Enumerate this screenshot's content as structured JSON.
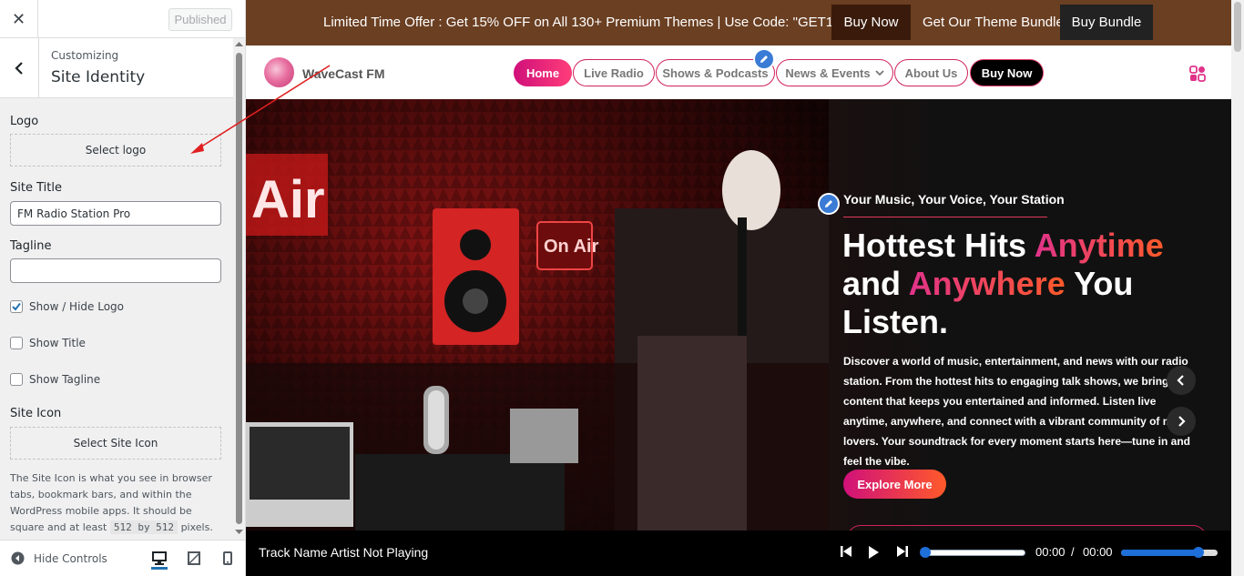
{
  "customizer": {
    "close_icon": "close-icon",
    "published_label": "Published",
    "customizing_label": "Customizing",
    "section_title": "Site Identity",
    "logo_label": "Logo",
    "select_logo_label": "Select logo",
    "site_title_label": "Site Title",
    "site_title_value": "FM Radio Station Pro",
    "tagline_label": "Tagline",
    "tagline_value": "",
    "checkboxes": [
      {
        "label": "Show / Hide Logo",
        "checked": true
      },
      {
        "label": "Show Title",
        "checked": false
      },
      {
        "label": "Show Tagline",
        "checked": false
      }
    ],
    "site_icon_label": "Site Icon",
    "select_site_icon_label": "Select Site Icon",
    "site_icon_desc_1": "The Site Icon is what you see in browser tabs, bookmark bars, and within the WordPress mobile apps. It should be square and at least",
    "site_icon_desc_code": "512 by 512",
    "site_icon_desc_2": "pixels.",
    "hide_controls_label": "Hide Controls",
    "device_icons": [
      "desktop-icon",
      "tablet-icon",
      "mobile-icon"
    ]
  },
  "preview": {
    "promo_text": "Limited Time Offer : Get 15% OFF on All 130+ Premium Themes | Use Code: \"GET15PRO\"",
    "promo_buy_now": "Buy Now",
    "theme_bundle_text": "Get Our Theme Bundle",
    "buy_bundle": "Buy Bundle",
    "brand": "WaveCast FM",
    "nav": [
      "Home",
      "Live Radio",
      "Shows & Podcasts",
      "News & Events",
      "About Us",
      "Buy Now"
    ],
    "hero_kicker": "Your Music, Your Voice, Your Station",
    "hero_title_1": "Hottest Hits ",
    "hero_title_2": "Anytime",
    "hero_title_3": "and ",
    "hero_title_4": "Anywhere",
    "hero_title_5": " You Listen.",
    "hero_desc": "Discover a world of music, entertainment, and news with our radio station. From the hottest hits to engaging talk shows, we bring you content that keeps you entertained and informed. Listen live anytime, anywhere, and connect with a vibrant community of music lovers. Your soundtrack for every moment starts here—tune in and feel the vibe.",
    "explore_label": "Explore More",
    "player": {
      "track": "Track Name Artist Not Playing",
      "time_current": "00:00",
      "time_sep": "/",
      "time_total": "00:00",
      "progress": 0,
      "volume": 0.8
    }
  },
  "colors": {
    "promo_bg": "#6b3f22",
    "accent_pink": "#d0107a",
    "accent_orange": "#ff5a2a",
    "wp_blue": "#2271b1"
  }
}
